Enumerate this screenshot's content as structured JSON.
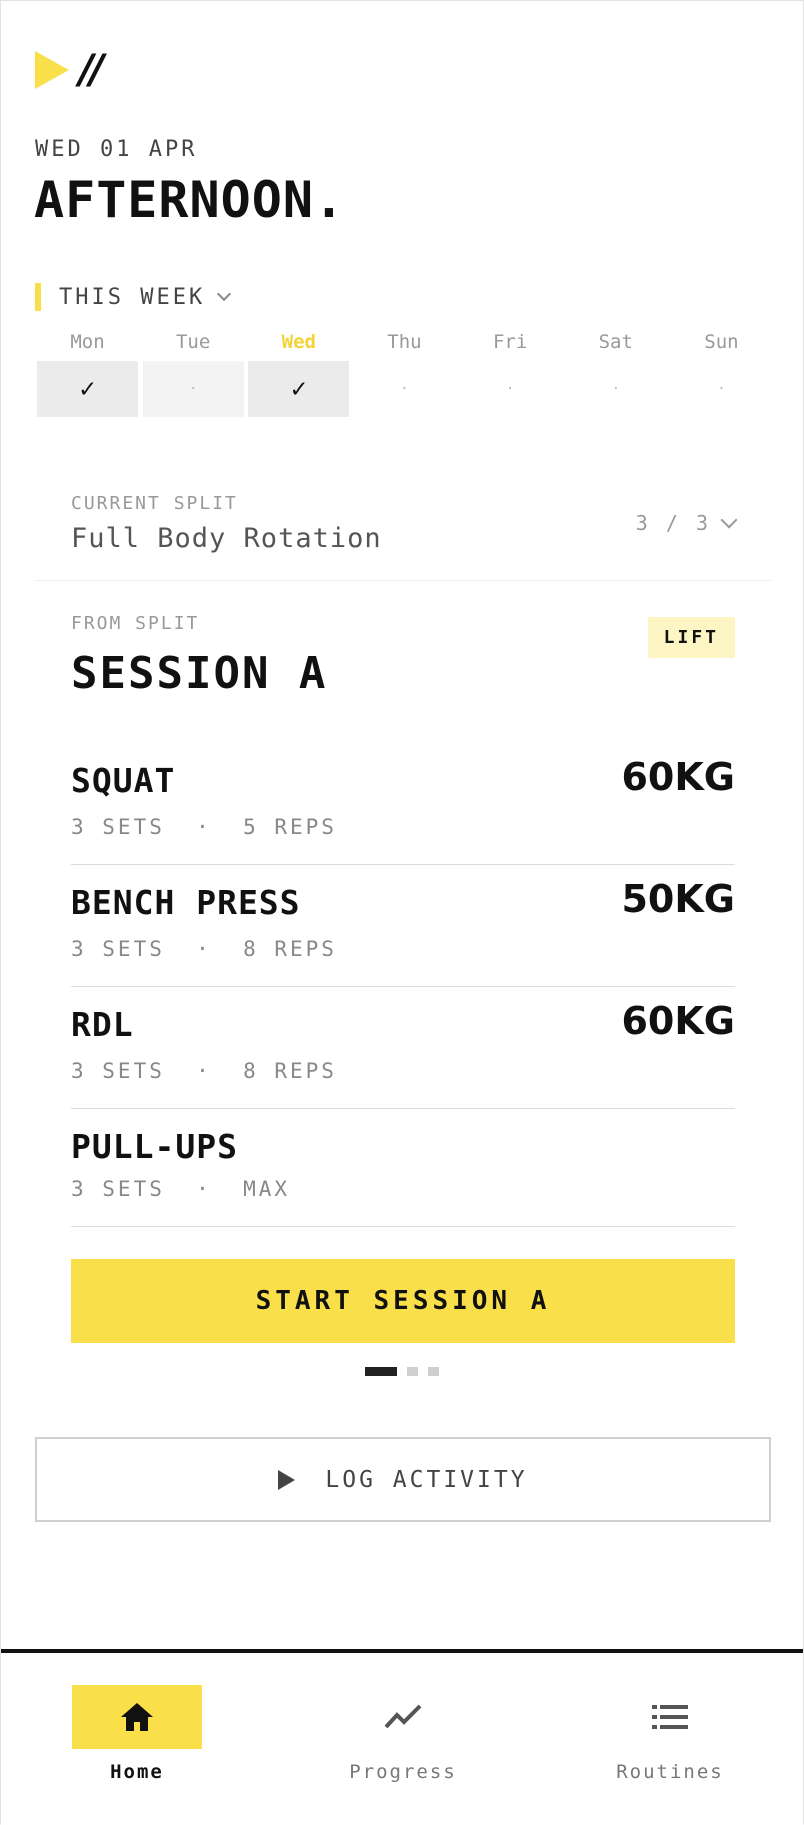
{
  "header": {
    "date": "WED 01 APR",
    "greeting": "AFTERNOON."
  },
  "week": {
    "label": "THIS WEEK",
    "days": [
      {
        "name": "Mon",
        "mark": "✓",
        "state": "done"
      },
      {
        "name": "Tue",
        "mark": "·",
        "state": "rest"
      },
      {
        "name": "Wed",
        "mark": "✓",
        "state": "done",
        "today": true
      },
      {
        "name": "Thu",
        "mark": "·",
        "state": "future"
      },
      {
        "name": "Fri",
        "mark": "·",
        "state": "future"
      },
      {
        "name": "Sat",
        "mark": "·",
        "state": "future"
      },
      {
        "name": "Sun",
        "mark": "·",
        "state": "future"
      }
    ]
  },
  "split": {
    "caption": "CURRENT SPLIT",
    "name": "Full Body Rotation",
    "count": "3 / 3"
  },
  "session": {
    "caption": "FROM SPLIT",
    "title": "SESSION A",
    "badge": "LIFT",
    "exercises": [
      {
        "name": "SQUAT",
        "meta": "3 SETS  ·  5 REPS",
        "weight": "60KG"
      },
      {
        "name": "BENCH PRESS",
        "meta": "3 SETS  ·  8 REPS",
        "weight": "50KG"
      },
      {
        "name": "RDL",
        "meta": "3 SETS  ·  8 REPS",
        "weight": "60KG"
      },
      {
        "name": "PULL-UPS",
        "meta": "3 SETS  ·  MAX",
        "weight": ""
      }
    ],
    "start_label": "START SESSION A",
    "pager": {
      "count": 3,
      "active": 0
    }
  },
  "log": {
    "label": "LOG ACTIVITY"
  },
  "nav": {
    "items": [
      {
        "label": "Home",
        "icon": "home-icon",
        "active": true
      },
      {
        "label": "Progress",
        "icon": "trending-up-icon",
        "active": false
      },
      {
        "label": "Routines",
        "icon": "list-icon",
        "active": false
      }
    ]
  },
  "colors": {
    "accent": "#f9e04b",
    "accent_soft": "#fdf6c4",
    "text": "#111111",
    "muted": "#888888"
  }
}
